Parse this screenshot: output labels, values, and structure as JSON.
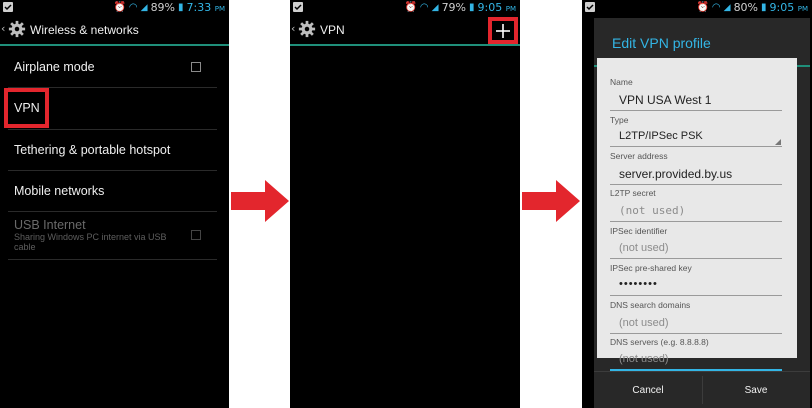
{
  "screen1": {
    "status": {
      "battery": "89%",
      "time": "7:33",
      "ampm": "PM"
    },
    "title": "Wireless & networks",
    "items": [
      {
        "label": "Airplane mode"
      },
      {
        "label": "VPN"
      },
      {
        "label": "Tethering & portable hotspot"
      },
      {
        "label": "Mobile networks"
      },
      {
        "label": "USB Internet",
        "sub1": "Sharing Windows PC internet via USB",
        "sub2": "cable"
      }
    ]
  },
  "screen2": {
    "status": {
      "battery": "79%",
      "time": "9:05",
      "ampm": "PM"
    },
    "title": "VPN",
    "add_icon": "plus-icon"
  },
  "screen3": {
    "status": {
      "battery": "80%",
      "time": "9:05",
      "ampm": "PM"
    },
    "dialog_title": "Edit VPN profile",
    "fields": {
      "name_label": "Name",
      "name_value": "VPN USA West 1",
      "type_label": "Type",
      "type_value": "L2TP/IPSec PSK",
      "server_label": "Server address",
      "server_value": "server.provided.by.us",
      "l2tp_label": "L2TP secret",
      "l2tp_placeholder": "(not used)",
      "ipsec_id_label": "IPSec identifier",
      "ipsec_id_placeholder": "(not used)",
      "psk_label": "IPSec pre-shared key",
      "psk_value": "••••••••",
      "dns_search_label": "DNS search domains",
      "dns_search_placeholder": "(not used)",
      "dns_servers_label": "DNS servers (e.g. 8.8.8.8)",
      "dns_servers_placeholder": "(not used)"
    },
    "buttons": {
      "cancel": "Cancel",
      "save": "Save"
    }
  },
  "colors": {
    "accent": "#33b5e5",
    "highlight": "#e3262d",
    "divider": "#1f8f7a"
  }
}
